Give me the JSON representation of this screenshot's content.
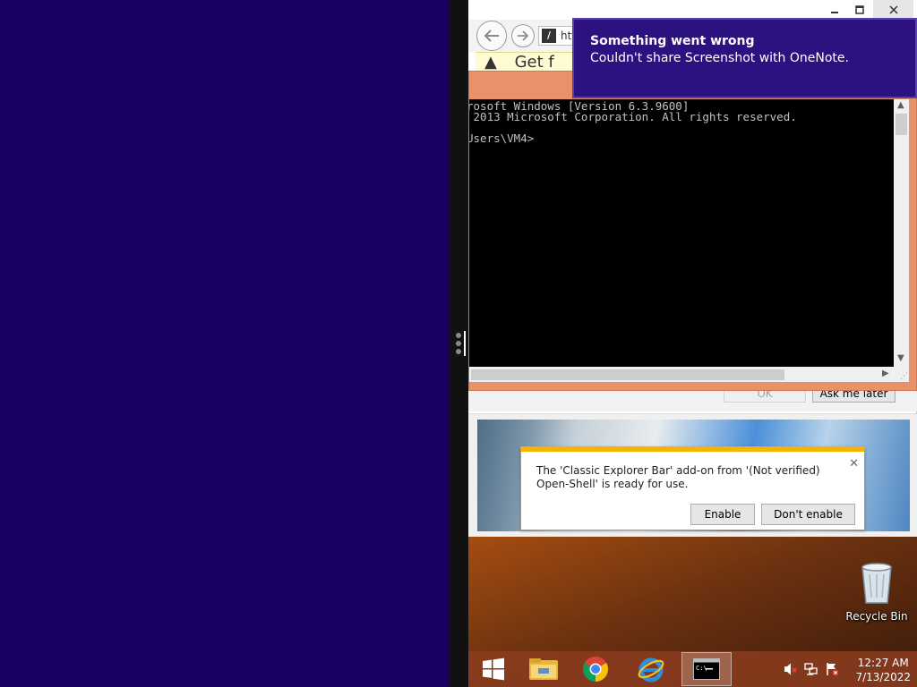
{
  "ie": {
    "address_text": "htt",
    "infobar_text": "Get f",
    "ok_label": "OK",
    "ask_later_label": "Ask me later"
  },
  "addon_notification": {
    "message": "The 'Classic Explorer Bar' add-on from '(Not verified) Open-Shell' is ready for use.",
    "enable_label": "Enable",
    "dont_enable_label": "Don't enable"
  },
  "cmd": {
    "lines": [
      "rosoft Windows [Version 6.3.9600]",
      " 2013 Microsoft Corporation. All rights reserved.",
      "",
      "Users\\VM4>"
    ]
  },
  "toast": {
    "title": "Something went wrong",
    "message": "Couldn't share Screenshot with OneNote."
  },
  "desktop": {
    "recycle_bin_label": "Recycle Bin"
  },
  "taskbar": {
    "items": [
      "start-icon",
      "file-explorer-icon",
      "chrome-icon",
      "internet-explorer-icon",
      "command-prompt-icon"
    ],
    "active_item": "command-prompt-icon"
  },
  "clock": {
    "time": "12:27 AM",
    "date": "7/13/2022"
  },
  "colors": {
    "left_background": "#170062",
    "toast_background": "#2c1180",
    "cmd_frame": "#e8926a",
    "notification_accent": "#f4b400"
  }
}
